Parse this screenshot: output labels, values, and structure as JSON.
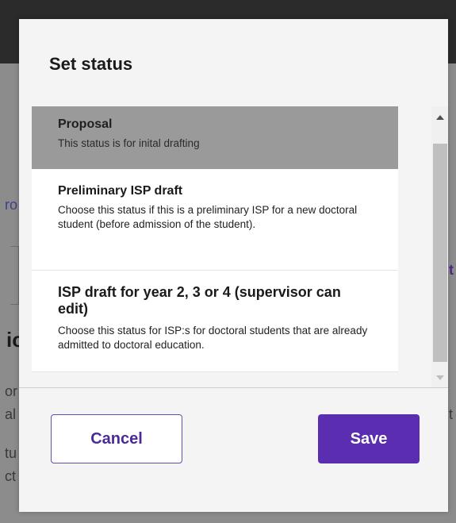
{
  "background": {
    "fragments": [
      "ro",
      "ic",
      "or",
      "al",
      "tu",
      "ct",
      "t",
      "t"
    ]
  },
  "modal": {
    "title": "Set status",
    "options": [
      {
        "title": "Proposal",
        "description": "This status is for inital drafting",
        "selected": true
      },
      {
        "title": "Preliminary ISP draft",
        "description": "Choose this status if this is a preliminary ISP for a new doctoral student (before admission of the student).",
        "selected": false
      },
      {
        "title": "ISP draft for year 2, 3 or 4 (supervisor can edit)",
        "description": "Choose this status for ISP:s for doctoral students that are already admitted to doctoral education.",
        "selected": false
      }
    ],
    "cancel_label": "Cancel",
    "save_label": "Save"
  },
  "colors": {
    "primary": "#5b2db0",
    "selected_row": "#9a9a9a",
    "overlay": "#8c8c8c"
  },
  "icons": {
    "scroll_up": "triangle-up-icon",
    "scroll_down": "triangle-down-icon"
  }
}
